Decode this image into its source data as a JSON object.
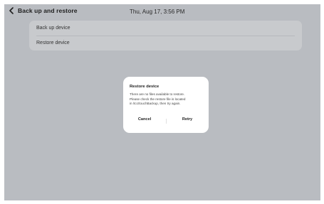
{
  "header": {
    "title": "Back up and restore",
    "datetime": "Thu, Aug 17, 3:56 PM",
    "back_icon": "chevron-left-icon"
  },
  "menu": {
    "items": [
      {
        "label": "Back up device"
      },
      {
        "label": "Restore device"
      }
    ]
  },
  "dialog": {
    "title": "Restore device",
    "message_lines": [
      "There are no files available to restore.",
      "Please check the restore file is located",
      "in /tcc/touchBackup, then try again."
    ],
    "cancel_label": "Cancel",
    "retry_label": "Retry"
  },
  "colors": {
    "overlay": "#b9bcc1",
    "menu_background": "#c8cacd",
    "dialog_background": "#ffffff"
  }
}
